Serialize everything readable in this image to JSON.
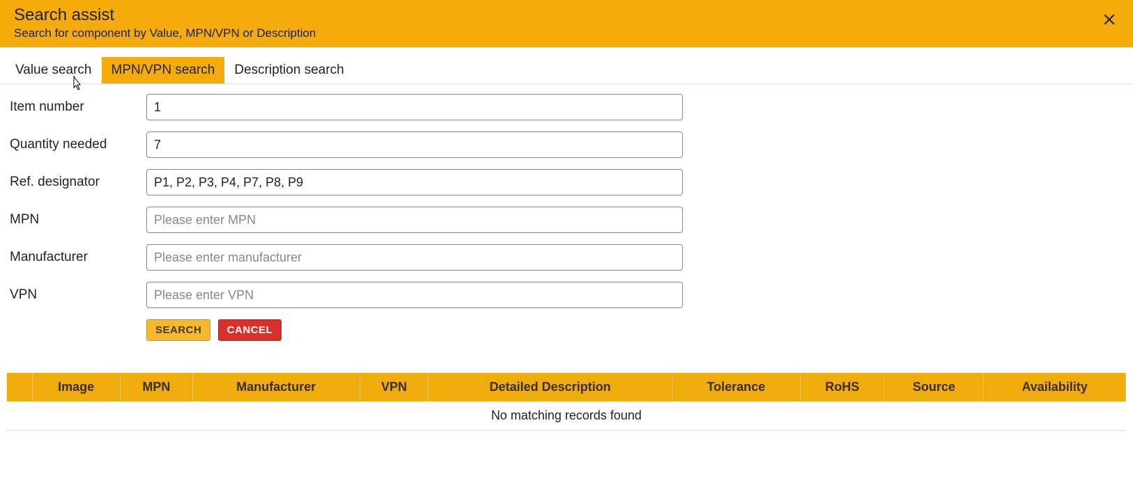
{
  "header": {
    "title": "Search assist",
    "subtitle": "Search for component by Value, MPN/VPN or Description"
  },
  "tabs": {
    "value": "Value search",
    "mpn": "MPN/VPN search",
    "description": "Description search",
    "active": "mpn"
  },
  "form": {
    "item_number": {
      "label": "Item number",
      "value": "1"
    },
    "quantity": {
      "label": "Quantity needed",
      "value": "7"
    },
    "ref_designator": {
      "label": "Ref. designator",
      "value": "P1, P2, P3, P4, P7, P8, P9"
    },
    "mpn": {
      "label": "MPN",
      "value": "",
      "placeholder": "Please enter MPN"
    },
    "manufacturer": {
      "label": "Manufacturer",
      "value": "",
      "placeholder": "Please enter manufacturer"
    },
    "vpn": {
      "label": "VPN",
      "value": "",
      "placeholder": "Please enter VPN"
    }
  },
  "buttons": {
    "search": "SEARCH",
    "cancel": "CANCEL"
  },
  "table": {
    "columns": [
      "",
      "Image",
      "MPN",
      "Manufacturer",
      "VPN",
      "Detailed Description",
      "Tolerance",
      "RoHS",
      "Source",
      "Availability"
    ],
    "empty": "No matching records found"
  }
}
